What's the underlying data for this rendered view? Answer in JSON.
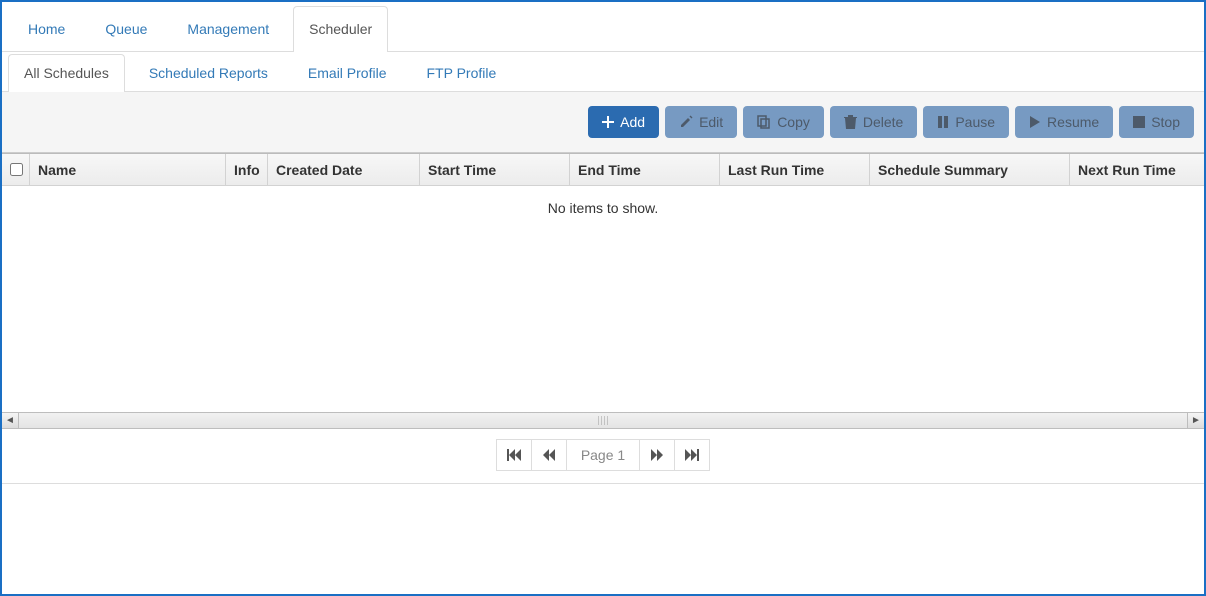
{
  "mainTabs": {
    "items": [
      {
        "label": "Home"
      },
      {
        "label": "Queue"
      },
      {
        "label": "Management"
      },
      {
        "label": "Scheduler"
      }
    ],
    "activeIndex": 3
  },
  "subTabs": {
    "items": [
      {
        "label": "All Schedules"
      },
      {
        "label": "Scheduled Reports"
      },
      {
        "label": "Email Profile"
      },
      {
        "label": "FTP Profile"
      }
    ],
    "activeIndex": 0
  },
  "toolbar": {
    "add": "Add",
    "edit": "Edit",
    "copy": "Copy",
    "delete": "Delete",
    "pause": "Pause",
    "resume": "Resume",
    "stop": "Stop"
  },
  "grid": {
    "columns": {
      "name": "Name",
      "info": "Info",
      "created": "Created Date",
      "start": "Start Time",
      "end": "End Time",
      "last": "Last Run Time",
      "summary": "Schedule Summary",
      "next": "Next Run Time"
    },
    "emptyMessage": "No items to show.",
    "rows": []
  },
  "pager": {
    "label": "Page 1"
  }
}
